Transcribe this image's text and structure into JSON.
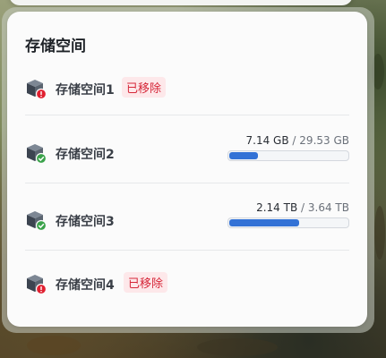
{
  "panel": {
    "title": "存储空间"
  },
  "pools": [
    {
      "name": "存储空间",
      "index": "1",
      "status": "removed",
      "status_label": "已移除",
      "status_icon": "error-badge-icon"
    },
    {
      "name": "存储空间",
      "index": "2",
      "status": "healthy",
      "status_icon": "check-badge-icon",
      "used": "7.14 GB",
      "separator": "/",
      "total": "29.53 GB",
      "usage_fraction": 0.24
    },
    {
      "name": "存储空间",
      "index": "3",
      "status": "healthy",
      "status_icon": "check-badge-icon",
      "used": "2.14 TB",
      "separator": "/",
      "total": "3.64 TB",
      "usage_fraction": 0.59
    },
    {
      "name": "存储空间",
      "index": "4",
      "status": "removed",
      "status_label": "已移除",
      "status_icon": "error-badge-icon"
    }
  ],
  "colors": {
    "bar_fill": "#3372d6",
    "removed_text": "#d6283a",
    "removed_bg": "#fde8ea",
    "ok_badge": "#3aa24a",
    "error_badge": "#e02030"
  }
}
